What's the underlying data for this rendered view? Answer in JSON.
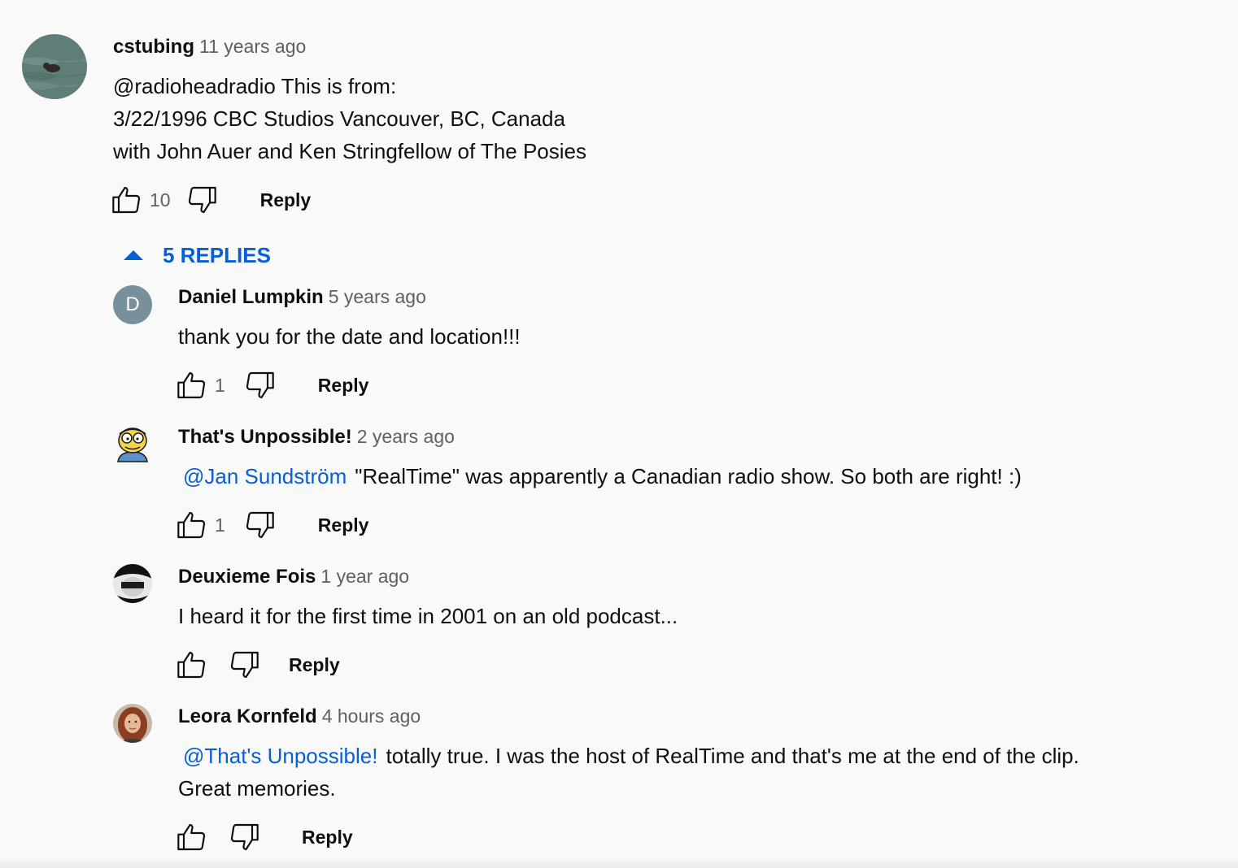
{
  "comments": {
    "main": {
      "author": "cstubing",
      "time": "11 years ago",
      "lines": [
        "@radioheadradio This is from:",
        "3/22/1996 CBC Studios Vancouver, BC, Canada",
        "with John Auer and Ken Stringfellow of The Posies"
      ],
      "likes": "10",
      "reply_label": "Reply"
    },
    "replies_toggle": "5 REPLIES",
    "replies": [
      {
        "author": "Daniel Lumpkin",
        "time": "5 years ago",
        "avatar_letter": "D",
        "text": "thank you for the date and location!!!",
        "likes": "1",
        "reply_label": "Reply"
      },
      {
        "author": "That's Unpossible!",
        "time": "2 years ago",
        "mention": "@Jan Sundström",
        "text": "\"RealTime\" was apparently a Canadian radio show. So both are right! :)",
        "likes": "1",
        "reply_label": "Reply"
      },
      {
        "author": "Deuxieme Fois",
        "time": "1 year ago",
        "text": "I heard it for the first time in 2001 on an old podcast...",
        "reply_label": "Reply"
      },
      {
        "author": "Leora Kornfeld",
        "time": "4 hours ago",
        "mention": "@That's Unpossible!",
        "text": "totally true. I was the host of RealTime and that's me at the end of the clip.",
        "text2": "Great memories.",
        "reply_label": "Reply"
      }
    ]
  },
  "icons": {
    "like": "thumbs-up-icon",
    "dislike": "thumbs-down-icon",
    "collapse": "caret-up-icon"
  },
  "colors": {
    "link": "#065fd4",
    "secondary_text": "#606060",
    "background": "#f9f9f9"
  }
}
